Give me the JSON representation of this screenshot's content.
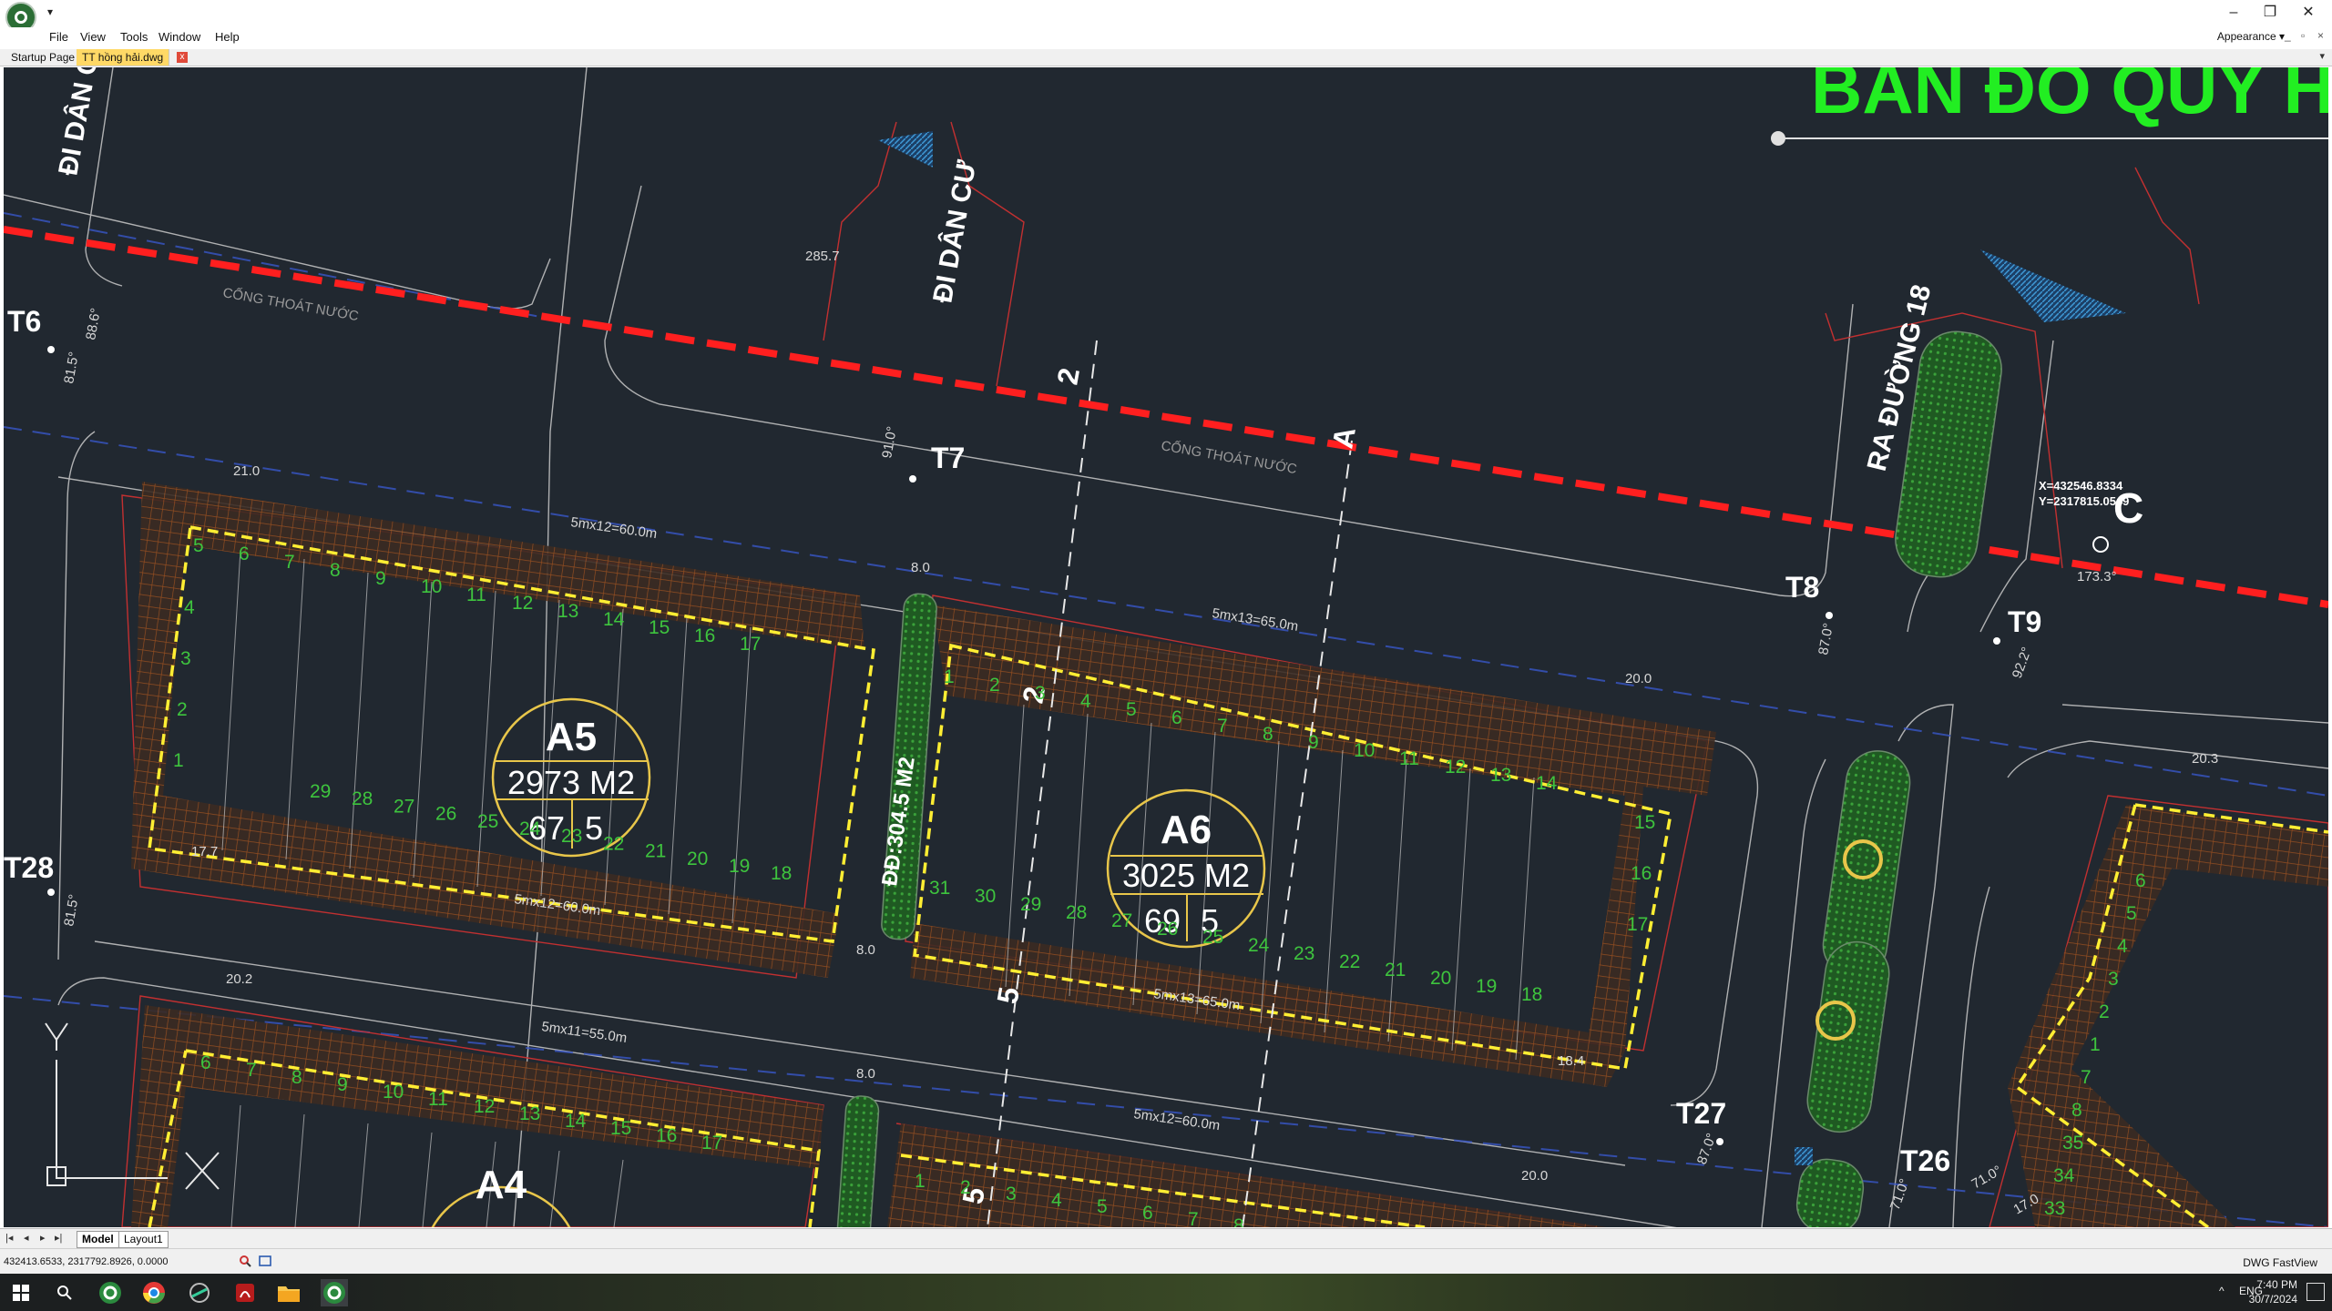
{
  "window": {
    "quick_access": "▾",
    "controls": {
      "minimize": "–",
      "restore": "❐",
      "close": "✕"
    }
  },
  "menu": {
    "items": [
      "File",
      "View",
      "Tools",
      "Window",
      "Help"
    ],
    "appearance": "Appearance ▾",
    "mini_controls": [
      "_",
      "▫",
      "×"
    ]
  },
  "tabs": {
    "startup": "Startup Page",
    "active": "TT hồng hải.dwg",
    "close": "x"
  },
  "drawing": {
    "title_banner": "BẢN ĐỒ QUY H",
    "roads": [
      "ĐI DÂN CƯ",
      "ĐI DÂN CƯ",
      "RA ĐƯỜNG 18"
    ],
    "drain_label": "CỐNG THOÁT NƯỚC",
    "points": [
      "T6",
      "T7",
      "T8",
      "T9",
      "T26",
      "T27",
      "T28",
      "C"
    ],
    "section_marks": [
      "2",
      "2",
      "A",
      "5",
      "5"
    ],
    "coord_readout": {
      "x": "X=432546.8334",
      "y": "Y=2317815.0549"
    },
    "blocks": [
      {
        "name": "A5",
        "area": "2973 M2",
        "lots": "67",
        "floors": "5"
      },
      {
        "name": "A6",
        "area": "3025 M2",
        "lots": "69",
        "floors": "5"
      },
      {
        "name": "A4",
        "area": "",
        "lots": "",
        "floors": ""
      }
    ],
    "green_strip": "ĐĐ:304.5 M2",
    "dims": [
      "21.0",
      "5mx12=60.0m",
      "5mx13=65.0m",
      "20.0",
      "17.7",
      "5mx12=60.0m",
      "5mx13=65.0m",
      "18.4",
      "20.2",
      "5mx11=55.0m",
      "5mx12=60.0m",
      "20.0",
      "20.3",
      "8.0",
      "8.0",
      "8.0",
      "285.7",
      "173.3°",
      "91.0°",
      "81.5°",
      "81.5°",
      "88.6°",
      "87.0°",
      "92.2°",
      "87.0°",
      "71.0°",
      "71.0°",
      "17.0"
    ],
    "a5_top_lots": [
      "5",
      "6",
      "7",
      "8",
      "9",
      "10",
      "11",
      "12",
      "13",
      "14",
      "15",
      "16",
      "17"
    ],
    "a5_bottom_lots": [
      "29",
      "28",
      "27",
      "26",
      "25",
      "24",
      "23",
      "22",
      "21",
      "20",
      "19",
      "18"
    ],
    "a5_side_lots": [
      "4",
      "3",
      "2",
      "1"
    ],
    "a6_top_lots": [
      "1",
      "2",
      "3",
      "4",
      "5",
      "6",
      "7",
      "8",
      "9",
      "10",
      "11",
      "12",
      "13",
      "14"
    ],
    "a6_bottom_lots": [
      "31",
      "30",
      "29",
      "28",
      "27",
      "26",
      "25",
      "24",
      "23",
      "22",
      "21",
      "20",
      "19",
      "18"
    ],
    "a6_side_lots": [
      "15",
      "16",
      "17"
    ],
    "a4_top_lots": [
      "6",
      "7",
      "8",
      "9",
      "10",
      "11",
      "12",
      "13",
      "14",
      "15",
      "16",
      "17"
    ],
    "a4_next_lots": [
      "1",
      "2",
      "3",
      "4",
      "5",
      "6",
      "7",
      "8"
    ],
    "right_block_lots": [
      "6",
      "5",
      "4",
      "3",
      "2",
      "1",
      "7",
      "8",
      "35",
      "34",
      "33"
    ]
  },
  "layout_tabs": {
    "nav": [
      "|◂",
      "◂",
      "▸",
      "▸|"
    ],
    "model": "Model",
    "layout1": "Layout1"
  },
  "status": {
    "coords": "432413.6533, 2317792.8926, 0.0000",
    "product": "DWG FastView"
  },
  "taskbar": {
    "tray_arrow": "^",
    "lang": "ENG",
    "time": "7:40 PM",
    "date": "30/7/2024"
  },
  "colors": {
    "canvas": "#212830",
    "lot_number": "#3ec43e",
    "boundary": "#ffee33",
    "centerline": "#ff2020",
    "banner": "#22ee22"
  }
}
